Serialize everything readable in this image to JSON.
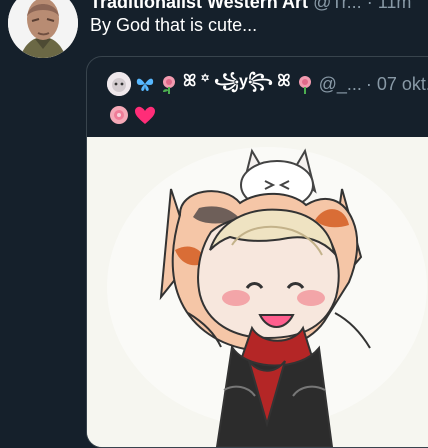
{
  "tweet": {
    "author_name": "Traditionalist Western Art",
    "author_handle": "@Tr...",
    "time_sep": "·",
    "time": "11m",
    "text": "By God that is cute..."
  },
  "quote": {
    "name": "ꕤ ꙳ ꧁y꧂ ꕤ",
    "handle": "@_...",
    "date": "· 07 okt."
  },
  "icons": [
    "avatar",
    "butterfly-icon",
    "flower-icon",
    "heart-icon",
    "rose-icon"
  ],
  "colors": {
    "background": "#15202b",
    "border": "#38444d",
    "secondary_text": "#8899a6"
  }
}
